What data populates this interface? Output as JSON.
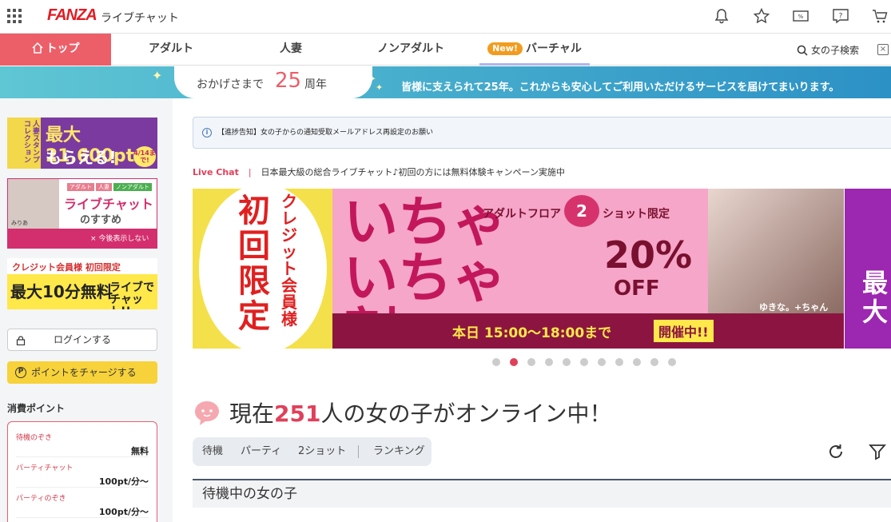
{
  "header": {
    "logo": "FANZA",
    "app_name": "ライブチャット"
  },
  "nav": {
    "top": "トップ",
    "adult": "アダルト",
    "married": "人妻",
    "nonadult": "ノンアダルト",
    "new_badge": "New!",
    "virtual": "バーチャル",
    "girl_search": "女の子検索"
  },
  "banner": {
    "prefix": "おかげさまで",
    "years": "25",
    "suffix": "周年",
    "message": "皆様に支えられて25年。これからも安心してご利用いただけるサービスを届けてまいります。"
  },
  "sidebar": {
    "ad1": {
      "side": "人妻スタンプコレクション",
      "line1": "最大21,600pt",
      "line2": "もらえる!",
      "date": "4/14まで!"
    },
    "ad2": {
      "tags": [
        "アダルト",
        "人妻",
        "ノンアダルト"
      ],
      "title": "ライブチャット",
      "subtitle": "のすすめ",
      "name": "みりあ"
    },
    "ad2_hide": "× 今後表示しない",
    "ad3": {
      "top": "クレジット会員様 初回限定",
      "main": "最大10分無料",
      "right": "ライブでチャット!!"
    },
    "login": "ログインする",
    "charge": "ポイントをチャージする",
    "points_title": "消費ポイント",
    "points": [
      {
        "name": "待機のぞき",
        "value": "無料"
      },
      {
        "name": "パーティチャット",
        "value": "100pt/分〜"
      },
      {
        "name": "パーティのぞき",
        "value": "100pt/分〜"
      }
    ]
  },
  "notice": "【進捗告知】女の子からの通知受取メールアドレス再設定のお願い",
  "live": {
    "label": "Live Chat",
    "sep": "|",
    "text": "日本最大級の総合ライブチャット♪初回の方には無料体験キャンペーン実施中"
  },
  "carousel": {
    "left": {
      "v1": "初回限定",
      "v2": "クレジット会員様"
    },
    "main": {
      "big": "いちゃいちゃ割",
      "floor": "アダルトフロア",
      "shot": "2",
      "shot_suffix": "ショット限定",
      "pct": "20%",
      "off": "OFF",
      "name": "ゆきな。+ちゃん",
      "time": "本日 15:00〜18:00まで",
      "status": "開催中!!"
    },
    "right": {
      "text": "最大"
    },
    "dots_total": 11,
    "active_dot": 2
  },
  "online": {
    "prefix": "現在",
    "count": "251",
    "suffix": "人の女の子がオンライン中！"
  },
  "tabs": [
    "待機",
    "パーティ",
    "2ショット",
    "ランキング"
  ],
  "section_title": "待機中の女の子",
  "colors": {
    "accent": "#ec5f69",
    "logo": "#e31b23",
    "banner_from": "#5fc6d4",
    "banner_to": "#2c91c5",
    "charge": "#f7d23a"
  }
}
